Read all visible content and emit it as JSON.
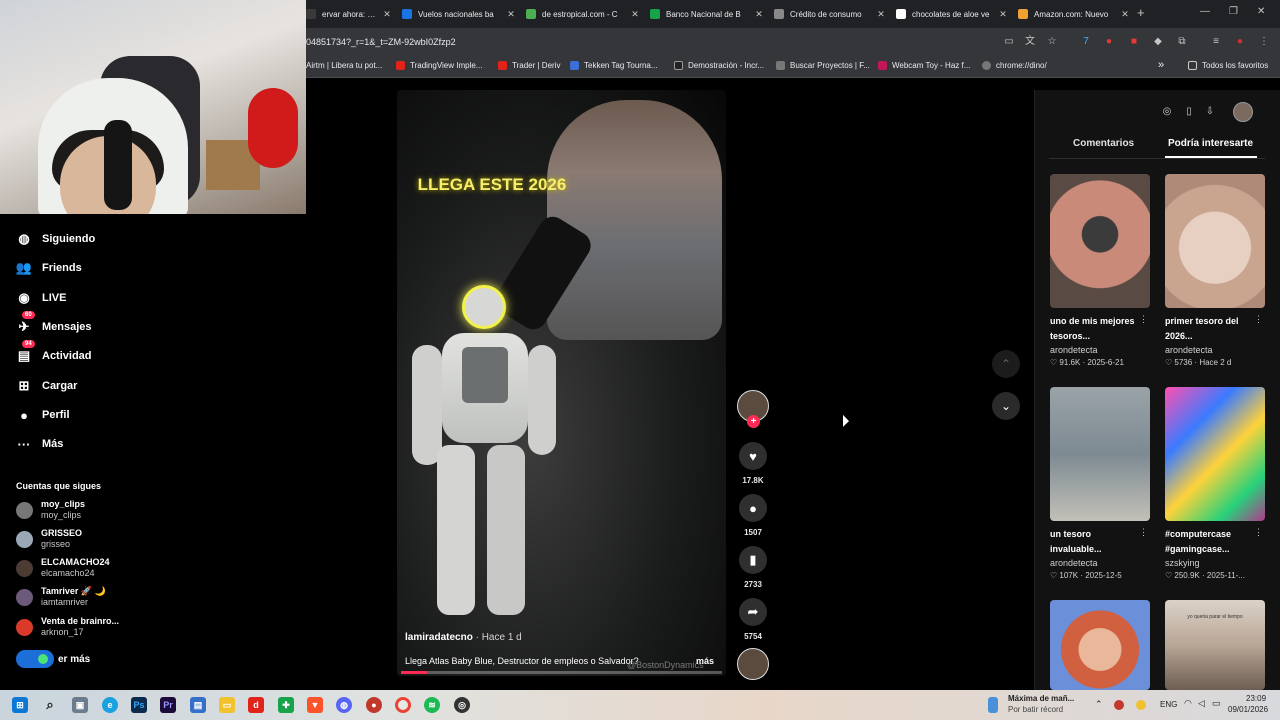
{
  "browser": {
    "tabs": [
      {
        "title": "ervar ahora: CB8 ...",
        "color": "#3a3a3a"
      },
      {
        "title": "Vuelos nacionales ba",
        "color": "#1a73e8"
      },
      {
        "title": "de estropical.com - C",
        "color": "#4caf50"
      },
      {
        "title": "Banco Nacional de B",
        "color": "#17a34a"
      },
      {
        "title": "Crédito de consumo",
        "color": "#888888"
      },
      {
        "title": "chocolates de aloe ve",
        "color": "#ffffff"
      },
      {
        "title": "Amazon.com: Nuevo",
        "color": "#f0a030"
      }
    ],
    "url": "04851734?_r=1&_t=ZM-92wbI0Zfzp2",
    "bookmarks": [
      {
        "label": "Airtm | Libera tu pot...",
        "color": "#6f6f6f"
      },
      {
        "label": "TradingView Imple...",
        "color": "#e2231a"
      },
      {
        "label": "Trader | Deriv",
        "color": "#e2231a"
      },
      {
        "label": "Tekken Tag Tourna...",
        "color": "#3a6fd8"
      },
      {
        "label": "Demostración - Incr...",
        "color": "#222222"
      },
      {
        "label": "Buscar Proyectos | F...",
        "color": "#777777"
      },
      {
        "label": "Webcam Toy - Haz f...",
        "color": "#c2185b"
      },
      {
        "label": "chrome://dino/",
        "color": "#777777"
      }
    ],
    "bookmarks_more": "»",
    "all_favorites": "Todos los favoritos"
  },
  "sidebar": {
    "items": [
      {
        "label": "Siguiendo",
        "icon": "following-icon"
      },
      {
        "label": "Friends",
        "icon": "friends-icon"
      },
      {
        "label": "LIVE",
        "icon": "live-icon"
      },
      {
        "label": "Mensajes",
        "icon": "messages-icon",
        "badge": "60"
      },
      {
        "label": "Actividad",
        "icon": "activity-icon",
        "badge": "94"
      },
      {
        "label": "Cargar",
        "icon": "upload-icon"
      },
      {
        "label": "Perfil",
        "icon": "profile-icon"
      },
      {
        "label": "Más",
        "icon": "more-icon"
      }
    ],
    "following_title": "Cuentas que sigues",
    "accounts": [
      {
        "name": "moy_clips",
        "handle": "moy_clips",
        "color": "#777777"
      },
      {
        "name": "GRISSEO",
        "handle": "grisseo",
        "color": "#9aa7b4"
      },
      {
        "name": "ELCAMACHO24",
        "handle": "elcamacho24",
        "color": "#4b3b33"
      },
      {
        "name": "Tamriver 🚀 🌙",
        "handle": "iamtamriver",
        "color": "#6d5a7a"
      },
      {
        "name": "Venta de brainro...",
        "handle": "arknon_17",
        "color": "#d93a2a"
      }
    ],
    "see_more": "er más"
  },
  "video": {
    "overlay_text": "LLEGA ESTE 2026",
    "author": "lamiradatecno",
    "time": "· Hace 1 d",
    "description": "Llega Atlas Baby Blue, Destructor de empleos o Salvador?",
    "more": "más",
    "watermark": "@BostonDynamics",
    "progress": 0.08
  },
  "actions": {
    "likes": "17.8K",
    "comments": "1507",
    "saves": "2733",
    "shares": "5754"
  },
  "right_panel": {
    "tab_comments": "Comentarios",
    "tab_suggested": "Podría interesarte",
    "cards": [
      {
        "title": "uno de mis mejores tesoros...",
        "author": "arondetecta",
        "likes": "91.6K",
        "date": "2025-6-21",
        "color": "#6b5a52"
      },
      {
        "title": "primer tesoro del 2026...",
        "author": "arondetecta",
        "likes": "5736",
        "date": "Hace 2 d",
        "color": "#c9a590"
      },
      {
        "title": "un tesoro invaluable...",
        "author": "arondetecta",
        "likes": "107K",
        "date": "2025-12-5",
        "color": "#7d8a92"
      },
      {
        "title": "#computercase #gamingcase...",
        "author": "szskying",
        "likes": "250.9K",
        "date": "2025-11-...",
        "color": "#b0398d"
      },
      {
        "title": "",
        "author": "",
        "likes": "",
        "date": "",
        "color": "#c07a52"
      },
      {
        "title": "",
        "author": "",
        "likes": "",
        "date": "",
        "color": "#b8a696"
      }
    ],
    "card5_overlay": "yo queria parar el tiempo"
  },
  "taskbar": {
    "notif_title": "Máxima de mañ...",
    "notif_sub": "Por batir récord",
    "lang": "ENG",
    "time": "23:09",
    "date": "09/01/2026"
  }
}
